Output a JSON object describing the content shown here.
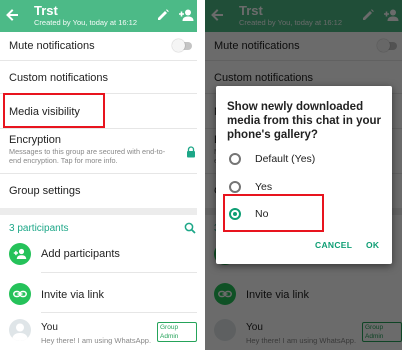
{
  "header": {
    "title": "Trst",
    "subtitle": "Created by You, today at 16:12"
  },
  "settings": {
    "mute": "Mute notifications",
    "custom": "Custom notifications",
    "media_visibility": "Media visibility",
    "encryption_title": "Encryption",
    "encryption_desc": "Messages to this group are secured with end-to-end encryption. Tap for more info.",
    "group_settings": "Group settings",
    "mute_enabled": false
  },
  "participants": {
    "count_label": "3 participants",
    "add_label": "Add participants",
    "invite_label": "Invite via link",
    "self_name": "You",
    "self_status": "Hey there! I am using WhatsApp.",
    "admin_badge": "Group Admin"
  },
  "dialog": {
    "title": "Show newly downloaded media from this chat in your phone's gallery?",
    "options": [
      "Default (Yes)",
      "Yes",
      "No"
    ],
    "selected": "No",
    "cancel": "CANCEL",
    "ok": "OK"
  },
  "colors": {
    "appbar": "#4cba87",
    "accent": "#0e9e74",
    "highlight": "#e8141e",
    "green_circle": "#25c25a"
  },
  "icons": [
    "back-arrow-icon",
    "pencil-icon",
    "add-person-icon",
    "lock-icon",
    "search-icon",
    "add-person-icon",
    "link-icon"
  ]
}
